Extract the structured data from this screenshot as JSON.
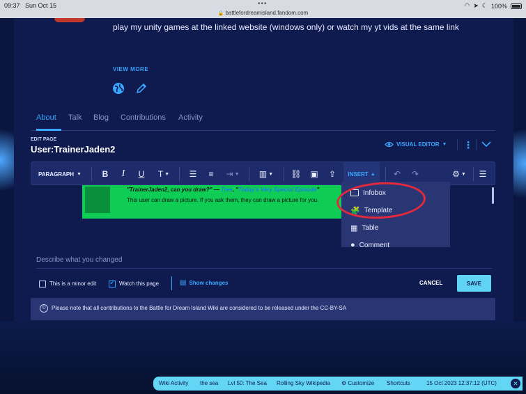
{
  "status_bar": {
    "time": "09:37",
    "date": "Sun Oct 15",
    "url": "battlefordreamisland.fandom.com",
    "battery": "100%"
  },
  "profile": {
    "bio": "play my unity games at the linked website (windows only)   or watch my yt vids at the same link",
    "view_more": "VIEW MORE"
  },
  "tabs": [
    {
      "label": "About",
      "active": true
    },
    {
      "label": "Talk"
    },
    {
      "label": "Blog"
    },
    {
      "label": "Contributions"
    },
    {
      "label": "Activity"
    }
  ],
  "editor": {
    "edit_label": "EDIT PAGE",
    "page_title": "User:TrainerJaden2",
    "visual_editor": "VISUAL EDITOR",
    "toolbar": {
      "paragraph": "PARAGRAPH",
      "insert": "INSERT"
    },
    "userbox": {
      "quote": "\"TrainerJaden2, can you draw?\"",
      "dash": " — ",
      "link1": "Tree",
      "comma": ", \"",
      "link2": "Today's Very Special Episode",
      "close_quote": "\"",
      "description": "This user can draw a picture. If you ask them, they can draw a picture for you."
    },
    "insert_menu": [
      "Infobox",
      "Template",
      "Table",
      "Comment"
    ],
    "summary_placeholder": "Describe what you changed",
    "minor_edit": "This is a minor edit",
    "watch_page": "Watch this page",
    "show_changes": "Show changes",
    "cancel": "CANCEL",
    "save": "SAVE",
    "license": "Please note that all contributions to the Battle for Dream Island Wiki are considered to be released under the CC-BY-SA"
  },
  "bottom_bar": {
    "items": [
      "Wiki Activity",
      "the sea",
      "Lvl 50: The Sea",
      "Rolling Sky Wikipedia",
      "Customize",
      "Shortcuts"
    ],
    "timestamp": "15 Oct 2023 12:37:12 (UTC)"
  },
  "colors": {
    "accent": "#39a7ff",
    "panel": "#0f1a4e",
    "save_button": "#60d4f4",
    "annotation": "#e5293c",
    "userbox": "#0fcc55"
  }
}
